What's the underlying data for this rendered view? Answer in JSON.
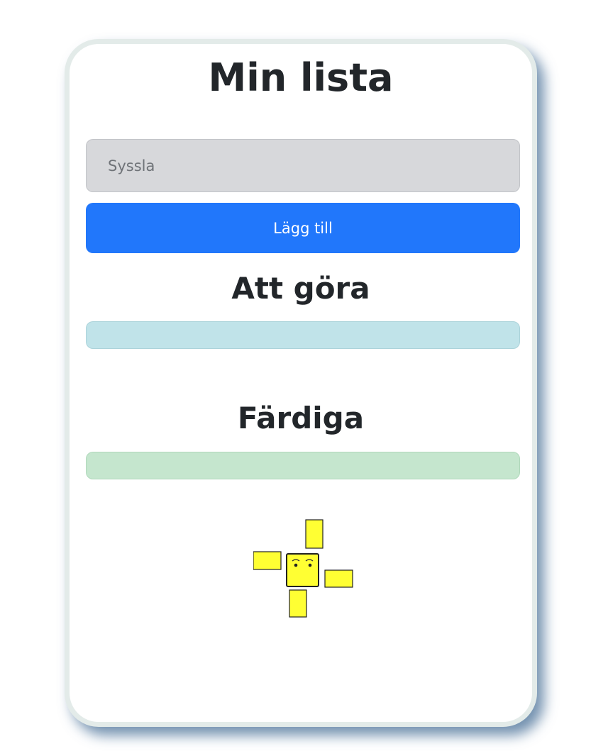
{
  "app": {
    "title": "Min lista"
  },
  "task_form": {
    "input_value": "",
    "input_placeholder": "Syssla",
    "add_button_label": "Lägg till",
    "button_color": "#2177fb"
  },
  "sections": {
    "todo": {
      "heading": "Att göra",
      "items": [],
      "color": "#c0e3e9"
    },
    "done": {
      "heading": "Färdiga",
      "items": [],
      "color": "#c5e6ce"
    }
  },
  "mascot": {
    "icon": "yellow-box-creature-icon",
    "color": "#ffff33"
  }
}
